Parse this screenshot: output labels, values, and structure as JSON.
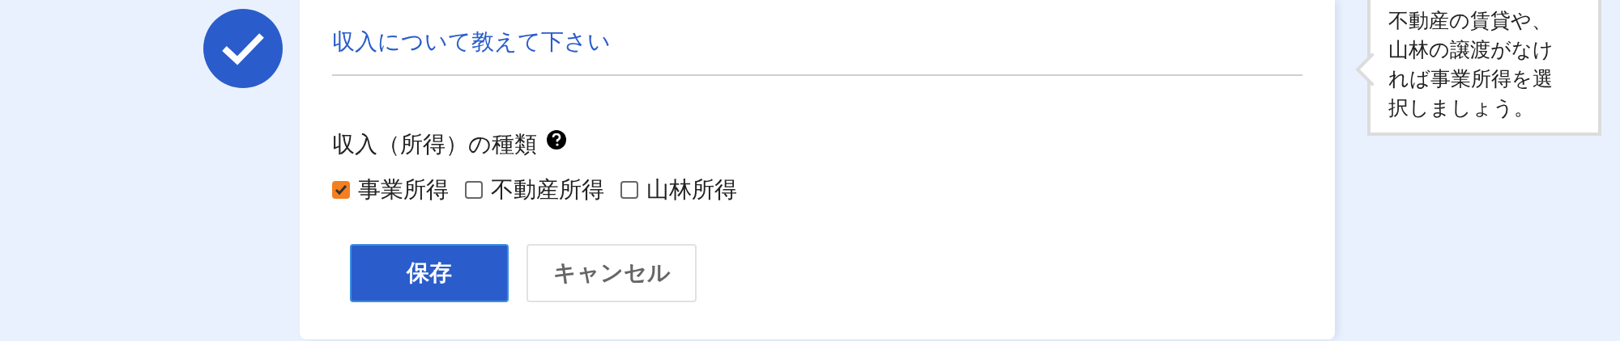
{
  "step": {
    "completed": true
  },
  "section": {
    "title": "収入について教えて下さい"
  },
  "field": {
    "label": "収入（所得）の種類",
    "help": true
  },
  "options": [
    {
      "label": "事業所得",
      "checked": true
    },
    {
      "label": "不動産所得",
      "checked": false
    },
    {
      "label": "山林所得",
      "checked": false
    }
  ],
  "buttons": [
    {
      "label": "保存",
      "kind": "primary"
    },
    {
      "label": "キャンセル",
      "kind": "secondary"
    }
  ],
  "tooltip": {
    "text": "不動産の賃貸や、山林の譲渡がなければ事業所得を選択しましょう。"
  }
}
